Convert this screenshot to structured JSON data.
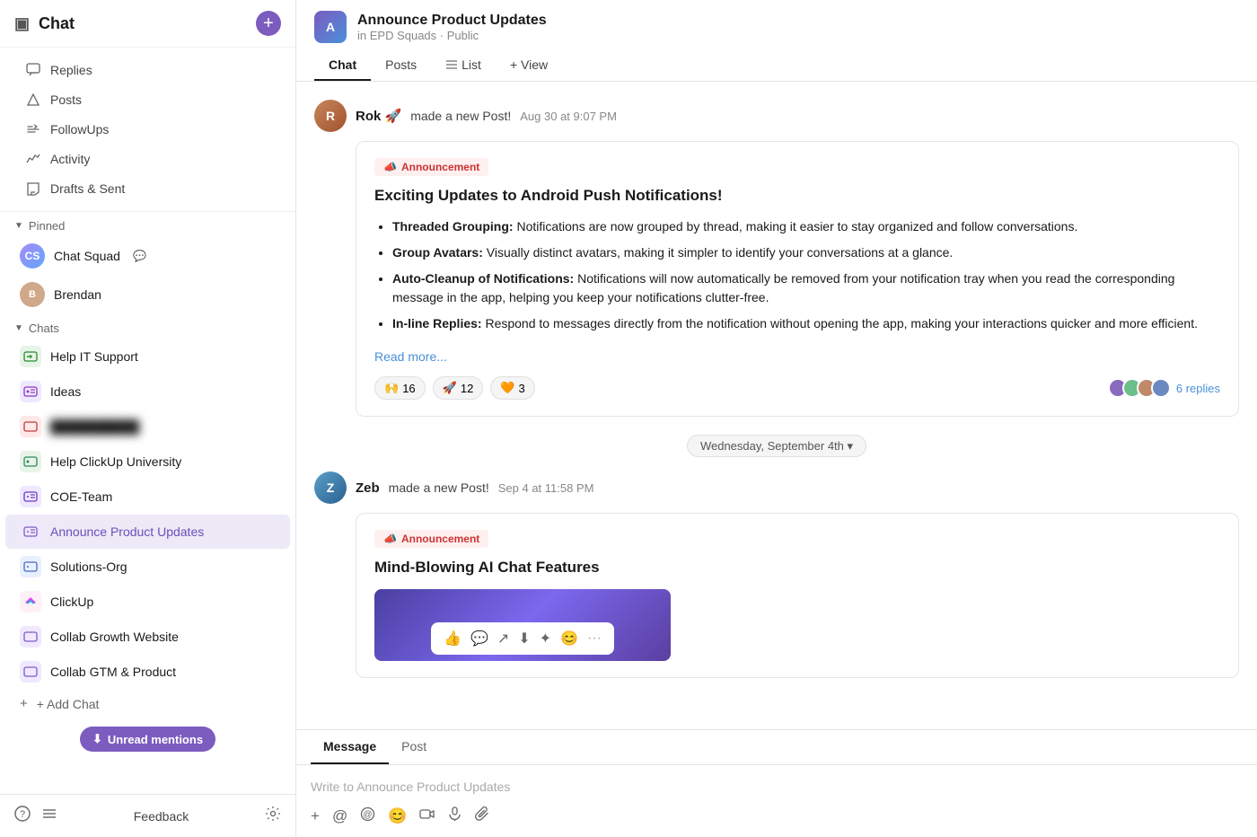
{
  "sidebar": {
    "title": "Chat",
    "add_btn_label": "+",
    "nav": [
      {
        "id": "replies",
        "label": "Replies",
        "icon": "💬"
      },
      {
        "id": "posts",
        "label": "Posts",
        "icon": "△"
      },
      {
        "id": "followups",
        "label": "FollowUps",
        "icon": "↔"
      },
      {
        "id": "activity",
        "label": "Activity",
        "icon": "📈"
      },
      {
        "id": "drafts",
        "label": "Drafts & Sent",
        "icon": "✉"
      }
    ],
    "pinned_label": "Pinned",
    "pinned_items": [
      {
        "id": "chat-squad",
        "label": "Chat Squad",
        "has_bubble": true
      },
      {
        "id": "brendan",
        "label": "Brendan"
      }
    ],
    "chats_label": "Chats",
    "chats": [
      {
        "id": "help-it-support",
        "label": "Help IT Support",
        "active": false
      },
      {
        "id": "ideas",
        "label": "Ideas",
        "active": false
      },
      {
        "id": "blurred",
        "label": "████████████",
        "blurred": true,
        "active": false
      },
      {
        "id": "help-clickup",
        "label": "Help ClickUp University",
        "active": false
      },
      {
        "id": "coe-team",
        "label": "COE-Team",
        "active": false
      },
      {
        "id": "announce-product-updates",
        "label": "Announce Product Updates",
        "active": true
      },
      {
        "id": "solutions-org",
        "label": "Solutions-Org",
        "active": false
      },
      {
        "id": "clickup",
        "label": "ClickUp",
        "active": false
      },
      {
        "id": "collab-growth",
        "label": "Collab Growth Website",
        "active": false
      },
      {
        "id": "collab-gtm",
        "label": "Collab GTM & Product",
        "active": false
      }
    ],
    "add_chat_label": "+ Add Chat",
    "footer": {
      "feedback_label": "Feedback"
    },
    "unread_mentions_label": "Unread mentions"
  },
  "channel": {
    "name": "Announce Product Updates",
    "subtitle": "in EPD Squads · Public",
    "tabs": [
      "Chat",
      "Posts",
      "List",
      "+ View"
    ],
    "active_tab": "Chat"
  },
  "messages": [
    {
      "id": "msg1",
      "author": "Rok 🚀",
      "action": "made a new Post!",
      "time": "Aug 30 at 9:07 PM",
      "tag": "📣 Announcement",
      "title": "Exciting Updates to Android Push Notifications!",
      "bullets": [
        {
          "bold": "Threaded Grouping:",
          "text": " Notifications are now grouped by thread, making it easier to stay organized and follow conversations."
        },
        {
          "bold": "Group Avatars:",
          "text": " Visually distinct avatars, making it simpler to identify your conversations at a glance."
        },
        {
          "bold": "Auto-Cleanup of Notifications:",
          "text": " Notifications will now automatically be removed from your notification tray when you read the corresponding message in the app, helping you keep your notifications clutter-free."
        },
        {
          "bold": "In-line Replies:",
          "text": " Respond to messages directly from the notification without opening the app, making your interactions quicker and more efficient."
        }
      ],
      "read_more": "Read more...",
      "reactions": [
        {
          "emoji": "🙌",
          "count": "16"
        },
        {
          "emoji": "🚀",
          "count": "12"
        },
        {
          "emoji": "🧡",
          "count": "3"
        }
      ],
      "replies_count": "6 replies"
    },
    {
      "id": "msg2",
      "author": "Zeb",
      "action": "made a new Post!",
      "time": "Sep 4 at 11:58 PM",
      "tag": "📣 Announcement",
      "title": "Mind-Blowing AI Chat Features"
    }
  ],
  "date_divider": "Wednesday, September 4th ▾",
  "input": {
    "tabs": [
      "Message",
      "Post"
    ],
    "active_tab": "Message",
    "placeholder": "Write to Announce Product Updates",
    "tools": [
      "+",
      "@",
      "📎",
      "😊",
      "📹",
      "🎤",
      "📋"
    ]
  },
  "icons": {
    "sidebar_toggle": "▣",
    "arrow_down": "⊕",
    "replies_icon": "💬",
    "posts_icon": "△",
    "followups_icon": "≈",
    "activity_icon": "⚡",
    "drafts_icon": "➤",
    "pinned_arrow": "▼",
    "chats_arrow": "▼"
  },
  "colors": {
    "accent_purple": "#7c5cbf",
    "active_bg": "#ede9f7",
    "active_text": "#6b4fbb",
    "link_blue": "#4a90d9",
    "announcement_red": "#cc3333",
    "announcement_bg": "#fff0f0"
  }
}
